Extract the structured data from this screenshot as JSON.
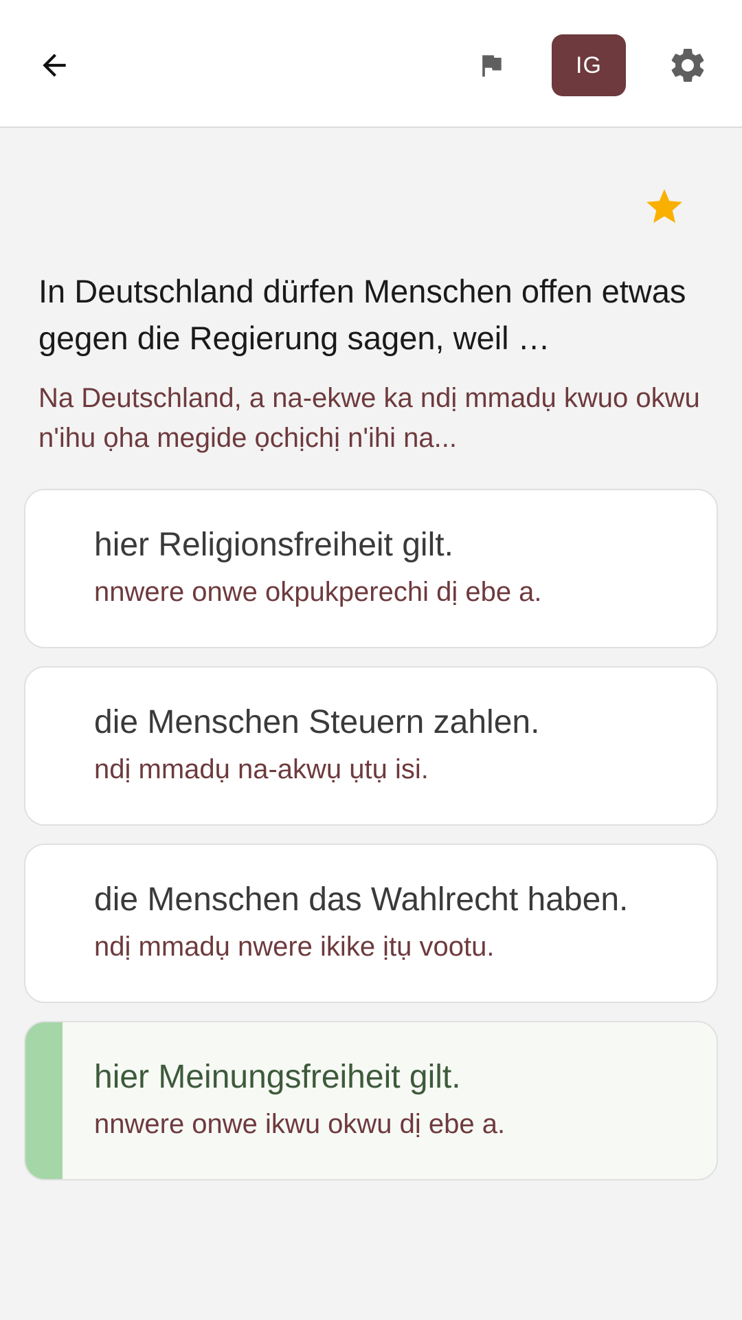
{
  "header": {
    "language_badge": "IG",
    "icons": [
      "arrow-back-icon",
      "flag-icon",
      "gear-icon"
    ]
  },
  "question": {
    "text_de": "In Deutschland dürfen Menschen offen etwas gegen die Regierung sagen, weil …",
    "text_ig": "Na Deutschland, a na-ekwe ka ndị mmadụ kwuo okwu n'ihu ọha megide ọchịchị n'ihi na...",
    "starred": true
  },
  "answers": [
    {
      "de": "hier Religionsfreiheit gilt.",
      "ig": "nnwere onwe okpukperechi dị ebe a.",
      "correct": false
    },
    {
      "de": "die Menschen Steuern zahlen.",
      "ig": "ndị mmadụ na-akwụ ụtụ isi.",
      "correct": false
    },
    {
      "de": "die Menschen das Wahlrecht haben.",
      "ig": "ndị mmadụ nwere ikike ịtụ vootu.",
      "correct": false
    },
    {
      "de": "hier Meinungsfreiheit gilt.",
      "ig": "nnwere onwe ikwu okwu dị ebe a.",
      "correct": true
    }
  ],
  "colors": {
    "accent": "#6e3a3d",
    "star": "#f9b000",
    "correct_bar": "#a5d6a7"
  }
}
